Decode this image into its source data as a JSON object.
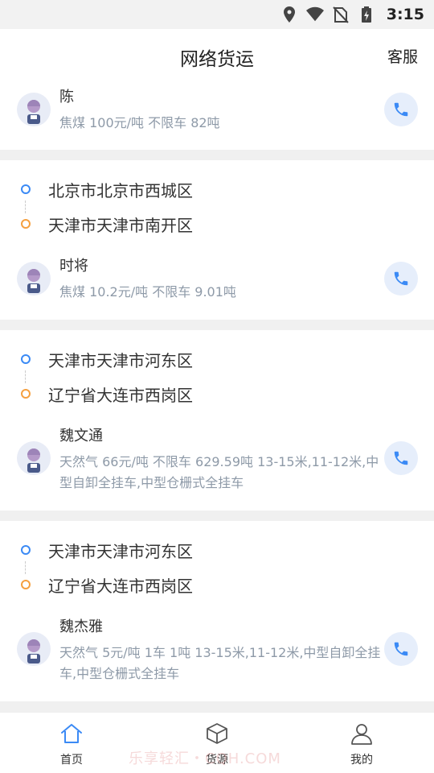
{
  "status_bar": {
    "time": "3:15"
  },
  "header": {
    "title": "网络货运",
    "service_label": "客服"
  },
  "cards": [
    {
      "shipper": "陈",
      "info": "焦煤 100元/吨 不限车 82吨"
    },
    {
      "from": "北京市北京市西城区",
      "to": "天津市天津市南开区",
      "shipper": "时将",
      "info": "焦煤 10.2元/吨 不限车 9.01吨"
    },
    {
      "from": "天津市天津市河东区",
      "to": "辽宁省大连市西岗区",
      "shipper": "魏文通",
      "info": "天然气 66元/吨 不限车 629.59吨 13-15米,11-12米,中型自卸全挂车,中型仓栅式全挂车"
    },
    {
      "from": "天津市天津市河东区",
      "to": "辽宁省大连市西岗区",
      "shipper": "魏杰雅",
      "info": "天然气 5元/吨 1车 1吨 13-15米,11-12米,中型自卸全挂车,中型仓栅式全挂车"
    }
  ],
  "tabs": [
    {
      "label": "首页",
      "icon": "home-icon",
      "active": true
    },
    {
      "label": "货源",
      "icon": "box-icon",
      "active": false
    },
    {
      "label": "我的",
      "icon": "user-icon",
      "active": false
    }
  ],
  "watermark": "乐享轻汇・CQH.COM",
  "colors": {
    "accent": "#3b8af5",
    "route_end": "#f5a040",
    "muted_text": "#8e9aa8"
  }
}
